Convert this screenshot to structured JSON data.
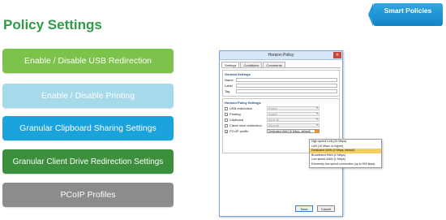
{
  "slide": {
    "title": "Policy Settings",
    "tag": "Smart Policies"
  },
  "pills": [
    {
      "label": "Enable / Disable USB Redirection"
    },
    {
      "label": "Enable / Disable Printing"
    },
    {
      "label": "Granular Clipboard Sharing Settings"
    },
    {
      "label": "Granular Client Drive Redirection Settings"
    },
    {
      "label": "PCoIP Profiles"
    }
  ],
  "dialog": {
    "title": "Horizon Policy",
    "tabs": [
      "Settings",
      "Conditions",
      "Comments"
    ],
    "general": {
      "title": "General Settings",
      "fields": [
        {
          "label": "Name"
        },
        {
          "label": "Label"
        },
        {
          "label": "Tag"
        }
      ]
    },
    "policy": {
      "title": "Horizon Policy Settings",
      "rows": [
        {
          "label": "USB redirection",
          "value": "Enable",
          "checked": false
        },
        {
          "label": "Printing",
          "value": "Enable",
          "checked": false
        },
        {
          "label": "Clipboard",
          "value": "Allow all",
          "checked": false
        },
        {
          "label": "Client drive redirection",
          "value": "Allow all",
          "checked": false
        },
        {
          "label": "PCoIP profile",
          "value": "Dedicated WAN (5 Mbps, default)",
          "checked": true
        }
      ]
    },
    "dropdown_options": [
      {
        "label": "High speed LAN (20 Mbps)",
        "selected": false
      },
      {
        "label": "LAN (10 Mbps or higher)",
        "selected": false
      },
      {
        "label": "Dedicated WAN (5 Mbps, default)",
        "selected": true
      },
      {
        "label": "Broadband WAN (2 Mbps)",
        "selected": false
      },
      {
        "label": "Low speed WAN (1 Mbps)",
        "selected": false
      },
      {
        "label": "Extremely low speed connection (up to 900 kbps)",
        "selected": false
      }
    ],
    "buttons": {
      "ok": "Save",
      "cancel": "Cancel"
    }
  },
  "colors": {
    "title_green": "#2f9a47",
    "tag_blue": "#1f97d8",
    "pill_usb": "#7dc24b",
    "pill_printing": "#a6daea",
    "pill_clipboard": "#1ba3dd",
    "pill_drive": "#3b8f3d",
    "pill_pcoip": "#8c8c8c",
    "selection": "#f5cf61"
  }
}
